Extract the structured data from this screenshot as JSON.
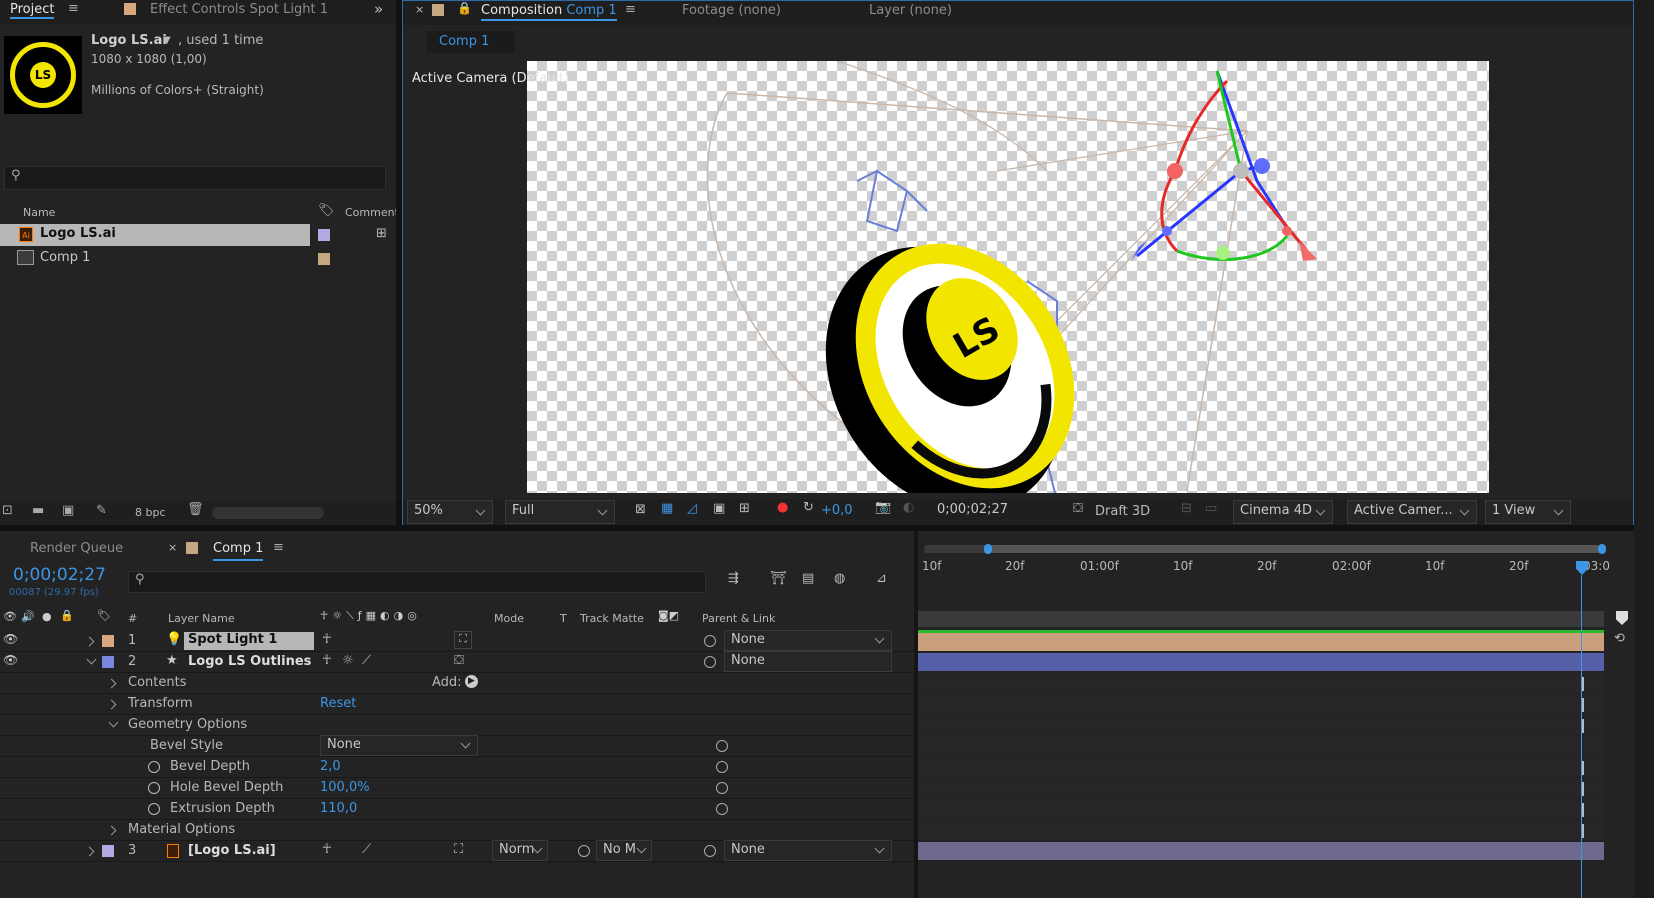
{
  "project_panel": {
    "tab_project": "Project",
    "tab_effect_controls": "Effect Controls Spot Light 1",
    "asset_name": "Logo LS.ai",
    "asset_used": ", used 1 time",
    "asset_size": "1080 x 1080 (1,00)",
    "asset_colors": "Millions of Colors+ (Straight)",
    "thumbnail_text": "LS",
    "col_name": "Name",
    "col_comment": "Comment",
    "items": [
      {
        "name": "Logo LS.ai",
        "label_color": "#b4a8e0"
      },
      {
        "name": "Comp 1",
        "label_color": "#c4a882"
      }
    ],
    "bpc": "8 bpc"
  },
  "comp_panel": {
    "tab_composition_prefix": "Composition",
    "tab_composition_name": "Comp 1",
    "tab_footage": "Footage  (none)",
    "tab_layer": "Layer  (none)",
    "breadcrumb": "Comp 1",
    "camera_label": "Active Camera (Default)",
    "logo_text": "LS",
    "bottom_bar": {
      "zoom": "50%",
      "resolution": "Full",
      "exposure": "+0,0",
      "timecode": "0;00;02;27",
      "draft": "Draft 3D",
      "renderer": "Cinema 4D",
      "camera": "Active Camer...",
      "views": "1 View"
    }
  },
  "timeline": {
    "tab_render_queue": "Render Queue",
    "tab_comp": "Comp 1",
    "current_time": "0;00;02;27",
    "frame_info": "00087 (29.97 fps)",
    "headers": {
      "num": "#",
      "layer_name": "Layer Name",
      "mode": "Mode",
      "t": "T",
      "track_matte": "Track Matte",
      "parent": "Parent & Link"
    },
    "ruler": [
      "10f",
      "20f",
      "01:00f",
      "10f",
      "20f",
      "02:00f",
      "10f",
      "20f",
      "03:0"
    ],
    "layers": [
      {
        "num": "1",
        "name": "Spot Light 1",
        "parent": "None",
        "label_color": "#d9a77e",
        "bar_color": "#caa07c"
      },
      {
        "num": "2",
        "name": "Logo LS Outlines",
        "parent": "None",
        "label_color": "#7a87e0",
        "bar_color": "#5560a8"
      },
      {
        "num": "3",
        "name": "[Logo LS.ai]",
        "parent": "None",
        "mode": "Norm",
        "matte": "No M",
        "label_color": "#b4a8e0",
        "bar_color": "#6e6a8e"
      }
    ],
    "properties": {
      "contents": "Contents",
      "add_label": "Add:",
      "transform": "Transform",
      "reset": "Reset",
      "geometry_options": "Geometry Options",
      "bevel_style": "Bevel Style",
      "bevel_style_value": "None",
      "bevel_depth": "Bevel Depth",
      "bevel_depth_value": "2,0",
      "hole_bevel_depth": "Hole Bevel Depth",
      "hole_bevel_depth_value": "100,0%",
      "extrusion_depth": "Extrusion Depth",
      "extrusion_depth_value": "110,0",
      "material_options": "Material Options"
    }
  },
  "colors": {
    "accent_blue": "#3d95e5",
    "logo_yellow": "#f2e600",
    "panel_bg": "#232323"
  }
}
